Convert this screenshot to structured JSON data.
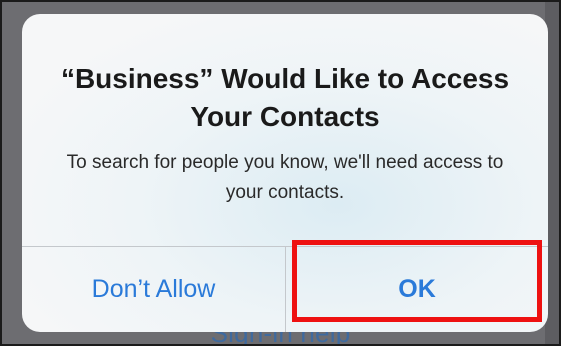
{
  "background": {
    "link_label": "Sign-in help"
  },
  "alert": {
    "title": "“Business” Would Like to Access Your Contacts",
    "message": "To search for people you know, we'll need access to your contacts.",
    "deny_label": "Don’t Allow",
    "ok_label": "OK"
  },
  "colors": {
    "button_text": "#2a7ad9",
    "highlight": "#ee1111",
    "backdrop": "#6d6d71"
  }
}
